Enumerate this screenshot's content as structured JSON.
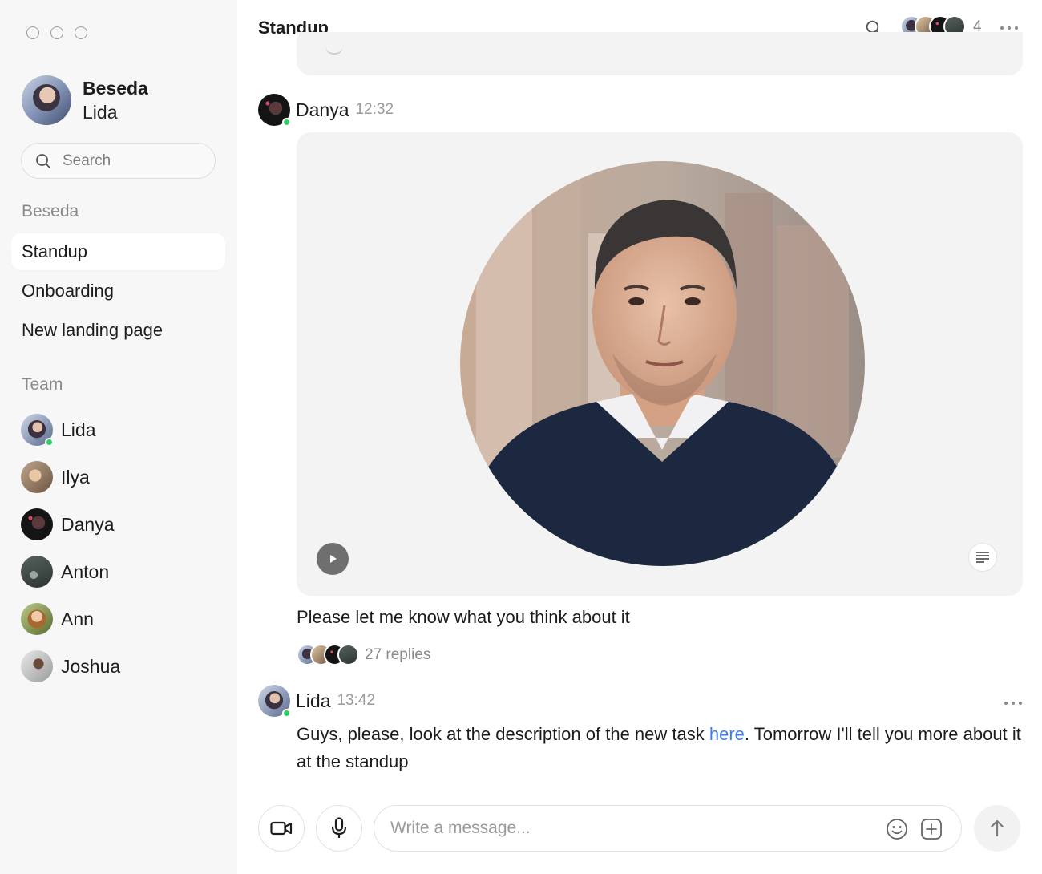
{
  "window": {
    "controls": [
      "close",
      "minimize",
      "maximize"
    ]
  },
  "profile": {
    "workspace": "Beseda",
    "user": "Lida",
    "status": "online"
  },
  "sidebar": {
    "search_label": "Search",
    "workspace_section": "Beseda",
    "channels": [
      {
        "label": "Standup",
        "active": true
      },
      {
        "label": "Onboarding",
        "active": false
      },
      {
        "label": "New landing page",
        "active": false
      }
    ],
    "team_section": "Team",
    "team": [
      {
        "name": "Lida",
        "online": true
      },
      {
        "name": "Ilya",
        "online": false
      },
      {
        "name": "Danya",
        "online": false
      },
      {
        "name": "Anton",
        "online": false
      },
      {
        "name": "Ann",
        "online": false
      },
      {
        "name": "Joshua",
        "online": false
      }
    ]
  },
  "header": {
    "title": "Standup",
    "member_count": "4",
    "icons": [
      "search-icon",
      "more-icon"
    ]
  },
  "messages": [
    {
      "author": "Danya",
      "time": "12:32",
      "attachment": "video-message",
      "text": "Please let me know what you think about it",
      "replies": "27 replies"
    },
    {
      "author": "Lida",
      "time": "13:42",
      "text_before_link": "Guys, please, look at the description of the new task ",
      "link_text": "here",
      "text_after_link": ". Tomorrow I'll tell you more about it at the standup"
    }
  ],
  "composer": {
    "placeholder": "Write a message...",
    "value": "",
    "icons": [
      "video-icon",
      "mic-icon",
      "emoji-icon",
      "attach-icon",
      "send-icon"
    ]
  },
  "colors": {
    "sidebar_bg": "#f7f7f7",
    "bubble_bg": "#f3f3f3",
    "link": "#3f7ee8",
    "online": "#2fcf63",
    "muted_text": "#8a8a8a"
  }
}
